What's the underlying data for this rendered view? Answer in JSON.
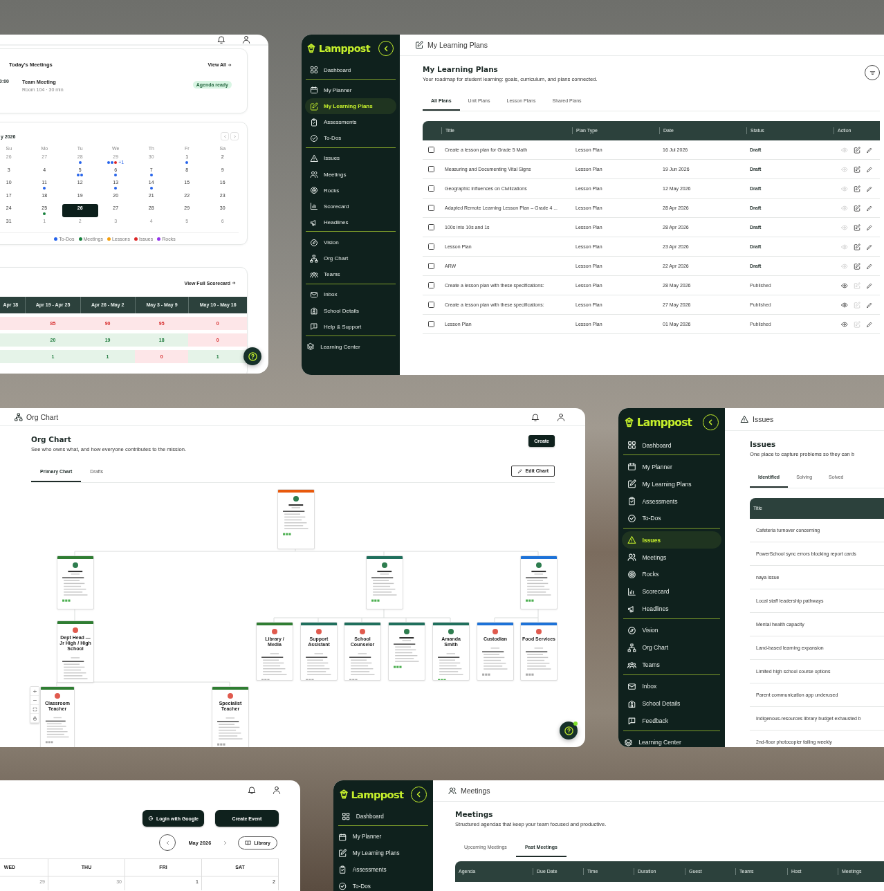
{
  "dashboard_panel": {
    "meetings_card": {
      "title": "Today's Meetings",
      "view_all": "View All",
      "meeting": {
        "time": "0:00",
        "title": "Team Meeting",
        "details": "Room 104 · 30 min",
        "badge": "Agenda ready"
      }
    },
    "calendar_card": {
      "month": "y 2026",
      "weekdays": [
        "Su",
        "Mo",
        "Tu",
        "We",
        "Th",
        "Fr",
        "Sa"
      ],
      "weeks": [
        [
          {
            "day": "26",
            "muted": true,
            "selected": false
          },
          {
            "day": "27",
            "muted": true,
            "selected": false
          },
          {
            "day": "28",
            "muted": true,
            "selected": false,
            "dots": [
              {
                "color": "#2563eb"
              }
            ]
          },
          {
            "day": "29",
            "muted": true,
            "selected": false,
            "dots": [
              {
                "color": "#2563eb"
              },
              {
                "color": "#2563eb"
              },
              {
                "color": "#dc2626"
              }
            ],
            "more": "+1"
          },
          {
            "day": "30",
            "muted": true,
            "selected": false
          },
          {
            "day": "1",
            "muted": false,
            "selected": false,
            "dots": [
              {
                "color": "#2563eb"
              }
            ]
          },
          {
            "day": "2",
            "muted": false,
            "selected": false
          }
        ],
        [
          {
            "day": "3",
            "muted": false,
            "selected": false
          },
          {
            "day": "4",
            "muted": false,
            "selected": false
          },
          {
            "day": "5",
            "muted": false,
            "selected": false,
            "dots": [
              {
                "color": "#2563eb"
              },
              {
                "color": "#2563eb"
              }
            ]
          },
          {
            "day": "6",
            "muted": false,
            "selected": false,
            "dots": [
              {
                "color": "#2563eb"
              }
            ]
          },
          {
            "day": "7",
            "muted": false,
            "selected": false,
            "dots": [
              {
                "color": "#2563eb"
              }
            ]
          },
          {
            "day": "8",
            "muted": false,
            "selected": false
          },
          {
            "day": "9",
            "muted": false,
            "selected": false
          }
        ],
        [
          {
            "day": "10",
            "muted": false,
            "selected": false
          },
          {
            "day": "11",
            "muted": false,
            "selected": false,
            "dots": [
              {
                "color": "#2563eb"
              }
            ]
          },
          {
            "day": "12",
            "muted": false,
            "selected": false
          },
          {
            "day": "13",
            "muted": false,
            "selected": false,
            "dots": [
              {
                "color": "#2563eb"
              }
            ]
          },
          {
            "day": "14",
            "muted": false,
            "selected": false,
            "dots": [
              {
                "color": "#2563eb"
              }
            ]
          },
          {
            "day": "15",
            "muted": false,
            "selected": false
          },
          {
            "day": "16",
            "muted": false,
            "selected": false
          }
        ],
        [
          {
            "day": "17",
            "muted": false,
            "selected": false
          },
          {
            "day": "18",
            "muted": false,
            "selected": false
          },
          {
            "day": "19",
            "muted": false,
            "selected": false
          },
          {
            "day": "20",
            "muted": false,
            "selected": false
          },
          {
            "day": "21",
            "muted": false,
            "selected": false
          },
          {
            "day": "22",
            "muted": false,
            "selected": false
          },
          {
            "day": "23",
            "muted": false,
            "selected": false
          }
        ],
        [
          {
            "day": "24",
            "muted": false,
            "selected": false
          },
          {
            "day": "25",
            "muted": false,
            "selected": false,
            "dots": [
              {
                "color": "#16803c"
              }
            ]
          },
          {
            "day": "26",
            "muted": false,
            "selected": true
          },
          {
            "day": "27",
            "muted": false,
            "selected": false
          },
          {
            "day": "28",
            "muted": false,
            "selected": false
          },
          {
            "day": "29",
            "muted": false,
            "selected": false
          },
          {
            "day": "30",
            "muted": false,
            "selected": false
          }
        ],
        [
          {
            "day": "31",
            "muted": false,
            "selected": false
          },
          {
            "day": "1",
            "muted": true,
            "selected": false
          },
          {
            "day": "2",
            "muted": true,
            "selected": false
          },
          {
            "day": "3",
            "muted": true,
            "selected": false
          },
          {
            "day": "4",
            "muted": true,
            "selected": false
          },
          {
            "day": "5",
            "muted": true,
            "selected": false
          },
          {
            "day": "6",
            "muted": true,
            "selected": false
          }
        ]
      ],
      "legend": [
        {
          "label": "To-Dos",
          "color": "#2563eb"
        },
        {
          "label": "Meetings",
          "color": "#16803c"
        },
        {
          "label": "Lessons",
          "color": "#f59e0b"
        },
        {
          "label": "Issues",
          "color": "#dc2626"
        },
        {
          "label": "Rocks",
          "color": "#9333ea"
        }
      ]
    },
    "scorecard_card": {
      "link": "View Full Scorecard",
      "columns": [
        "Apr 18",
        "Apr 19 - Apr 25",
        "Apr 26 - May 2",
        "May 3 - May 9",
        "May 10 - May 16"
      ],
      "rows": [
        {
          "cells": [
            {
              "on_track": false
            },
            {
              "value": "85",
              "on_track": false
            },
            {
              "value": "90",
              "on_track": false
            },
            {
              "value": "95",
              "on_track": false
            },
            {
              "value": "0",
              "on_track": false
            }
          ]
        },
        {
          "cells": [
            {
              "on_track": true
            },
            {
              "value": "20",
              "on_track": true
            },
            {
              "value": "19",
              "on_track": true
            },
            {
              "value": "18",
              "on_track": true
            },
            {
              "value": "0",
              "on_track": false
            }
          ]
        },
        {
          "cells": [
            {
              "on_track": true
            },
            {
              "value": "1",
              "on_track": true
            },
            {
              "value": "1",
              "on_track": true
            },
            {
              "value": "0",
              "on_track": false
            },
            {
              "value": "1",
              "on_track": true
            }
          ]
        }
      ]
    }
  },
  "learning_plans_panel": {
    "sidebar": {
      "logo": "Lamppost",
      "groups": [
        {
          "items": [
            {
              "label": "Dashboard",
              "selected": false
            }
          ]
        },
        {
          "items": [
            {
              "label": "My Planner",
              "selected": false
            },
            {
              "label": "My Learning Plans",
              "selected": true
            },
            {
              "label": "Assessments",
              "selected": false
            },
            {
              "label": "To-Dos",
              "selected": false
            }
          ]
        },
        {
          "items": [
            {
              "label": "Issues",
              "selected": false
            },
            {
              "label": "Meetings",
              "selected": false
            },
            {
              "label": "Rocks",
              "selected": false
            },
            {
              "label": "Scorecard",
              "selected": false
            },
            {
              "label": "Headlines",
              "selected": false
            }
          ]
        },
        {
          "items": [
            {
              "label": "Vision",
              "selected": false
            },
            {
              "label": "Org Chart",
              "selected": false
            },
            {
              "label": "Teams",
              "selected": false
            }
          ]
        },
        {
          "items": [
            {
              "label": "Inbox",
              "selected": false
            },
            {
              "label": "School Details",
              "selected": false
            },
            {
              "label": "Help & Support",
              "selected": false
            }
          ]
        },
        {
          "items": [
            {
              "label": "Learning Center",
              "selected": false
            }
          ]
        }
      ]
    },
    "header": "My Learning Plans",
    "title": "My Learning Plans",
    "subtitle": "Your roadmap for student learning: goals, curriculum, and plans connected.",
    "tabs": [
      {
        "label": "All Plans",
        "selected": true
      },
      {
        "label": "Unit Plans",
        "selected": false
      },
      {
        "label": "Lesson Plans",
        "selected": false
      },
      {
        "label": "Shared Plans",
        "selected": false
      }
    ],
    "table": {
      "columns": [
        "Title",
        "Plan Type",
        "Date",
        "Status",
        "Action"
      ],
      "rows": [
        {
          "title": "Create a lesson plan for Grade 5 Math",
          "type": "Lesson Plan",
          "date": "16 Jul 2026",
          "status": "Draft",
          "kind": "draft",
          "checked": false
        },
        {
          "title": "Measuring and Documenting Vital Signs",
          "type": "Lesson Plan",
          "date": "19 Jun 2026",
          "status": "Draft",
          "kind": "draft",
          "checked": false
        },
        {
          "title": "Geographic Influences on Civilizations",
          "type": "Lesson Plan",
          "date": "12 May 2026",
          "status": "Draft",
          "kind": "draft",
          "checked": false
        },
        {
          "title": "Adapted Remote Learning Lesson Plan – Grade 4 ...",
          "type": "Lesson Plan",
          "date": "28 Apr 2026",
          "status": "Draft",
          "kind": "draft",
          "checked": false
        },
        {
          "title": "100s into 10s and 1s",
          "type": "Lesson Plan",
          "date": "28 Apr 2026",
          "status": "Draft",
          "kind": "draft",
          "checked": false
        },
        {
          "title": "Lesson Plan",
          "type": "Lesson Plan",
          "date": "23 Apr 2026",
          "status": "Draft",
          "kind": "draft",
          "checked": false
        },
        {
          "title": "ARW",
          "type": "Lesson Plan",
          "date": "22 Apr 2026",
          "status": "Draft",
          "kind": "draft",
          "checked": false
        },
        {
          "title": "Create a lesson plan with these specifications:",
          "type": "Lesson Plan",
          "date": "28 May 2026",
          "status": "Published",
          "kind": "published",
          "checked": false
        },
        {
          "title": "Create a lesson plan with these specifications:",
          "type": "Lesson Plan",
          "date": "27 May 2026",
          "status": "Published",
          "kind": "published",
          "checked": false
        },
        {
          "title": "Lesson Plan",
          "type": "Lesson Plan",
          "date": "01 May 2026",
          "status": "Published",
          "kind": "published",
          "checked": false
        }
      ]
    }
  },
  "org_chart_panel": {
    "header": "Org Chart",
    "title": "Org Chart",
    "subtitle": "See who owns what, and how everyone contributes to the mission.",
    "create_button": "Create",
    "edit_button": "Edit Chart",
    "tabs": [
      {
        "label": "Primary Chart",
        "selected": true
      },
      {
        "label": "Drafts",
        "selected": false
      }
    ],
    "root": {
      "color": "#e8590c",
      "assigned": true,
      "children": [
        {
          "color": "#2f7d32",
          "assigned": true,
          "children": [
            {
              "title": "Dept Head — Jr High / High School",
              "color": "#2f7d32",
              "assigned": false,
              "children": [
                {
                  "title": "Classroom Teacher",
                  "color": "#2f7d32",
                  "assigned": false
                },
                {
                  "title": "Specialist Teacher",
                  "color": "#2f7d32",
                  "assigned": false
                }
              ]
            }
          ]
        },
        {
          "color": "#1f6f5c",
          "assigned": true,
          "children": [
            {
              "title": "Library / Media",
              "color": "#2f7d32",
              "assigned": false
            },
            {
              "title": "Support Assistant",
              "color": "#1f6f5c",
              "assigned": false
            },
            {
              "title": "School Counselor",
              "color": "#1f6f5c",
              "assigned": false
            },
            {
              "color": "#1f6f5c",
              "assigned": true
            },
            {
              "title": "Amanda Smith",
              "color": "#1f6f5c",
              "assigned": true
            }
          ]
        },
        {
          "color": "#1d72d8",
          "assigned": true,
          "children": [
            {
              "title": "Custodian",
              "color": "#1d72d8",
              "assigned": false
            },
            {
              "title": "Food Services",
              "color": "#1d72d8",
              "assigned": false
            }
          ]
        }
      ]
    }
  },
  "issues_panel": {
    "sidebar": {
      "logo": "Lamppost",
      "groups": [
        {
          "items": [
            {
              "label": "Dashboard",
              "selected": false
            }
          ]
        },
        {
          "items": [
            {
              "label": "My Planner",
              "selected": false
            },
            {
              "label": "My Learning Plans",
              "selected": false
            },
            {
              "label": "Assessments",
              "selected": false
            },
            {
              "label": "To-Dos",
              "selected": false
            }
          ]
        },
        {
          "items": [
            {
              "label": "Issues",
              "selected": true
            },
            {
              "label": "Meetings",
              "selected": false
            },
            {
              "label": "Rocks",
              "selected": false
            },
            {
              "label": "Scorecard",
              "selected": false
            },
            {
              "label": "Headlines",
              "selected": false
            }
          ]
        },
        {
          "items": [
            {
              "label": "Vision",
              "selected": false
            },
            {
              "label": "Org Chart",
              "selected": false
            },
            {
              "label": "Teams",
              "selected": false
            }
          ]
        },
        {
          "items": [
            {
              "label": "Inbox",
              "selected": false
            },
            {
              "label": "School Details",
              "selected": false
            },
            {
              "label": "Feedback",
              "selected": false
            }
          ]
        },
        {
          "items": [
            {
              "label": "Learning Center",
              "selected": false
            }
          ]
        }
      ]
    },
    "header": "Issues",
    "title": "Issues",
    "subtitle": "One place to capture problems so they can b",
    "tabs": [
      {
        "label": "Identified",
        "selected": true
      },
      {
        "label": "Solving",
        "selected": false
      },
      {
        "label": "Solved",
        "selected": false
      }
    ],
    "table": {
      "columns": [
        "Title"
      ],
      "rows": [
        "Cafeteria turnover concerning",
        "PowerSchool sync errors blocking report cards",
        "naya issue",
        "Local staff leadership pathways",
        "Mental health capacity",
        "Land-based learning expansion",
        "Limited high school course options",
        "Parent communication app underused",
        "Indigenous-resources library budget exhausted b",
        "2nd-floor photocopier failing weekly"
      ]
    }
  },
  "calendar_panel": {
    "google_button": "Login with Google",
    "create_button": "Create Event",
    "month": "May 2026",
    "library_button": "Library",
    "weekdays": [
      "WED",
      "THU",
      "FRI",
      "SAT"
    ],
    "days": [
      {
        "day": "29",
        "muted": true
      },
      {
        "day": "30",
        "muted": true
      },
      {
        "day": "1",
        "muted": false
      },
      {
        "day": "2",
        "muted": false
      }
    ]
  },
  "meetings_panel": {
    "sidebar": {
      "logo": "Lamppost",
      "groups": [
        {
          "items": [
            {
              "label": "Dashboard",
              "selected": false
            }
          ]
        },
        {
          "items": [
            {
              "label": "My Planner",
              "selected": false
            },
            {
              "label": "My Learning Plans",
              "selected": false
            },
            {
              "label": "Assessments",
              "selected": false
            },
            {
              "label": "To-Dos",
              "selected": false
            }
          ]
        }
      ]
    },
    "header": "Meetings",
    "title": "Meetings",
    "subtitle": "Structured agendas that keep your team focused and productive.",
    "tabs": [
      {
        "label": "Upcoming Meetings",
        "selected": false
      },
      {
        "label": "Past Meetings",
        "selected": true
      }
    ],
    "table": {
      "columns": [
        "Agenda",
        "Due Date",
        "Time",
        "Duration",
        "Guest",
        "Teams",
        "Host",
        "Meetings"
      ]
    }
  }
}
